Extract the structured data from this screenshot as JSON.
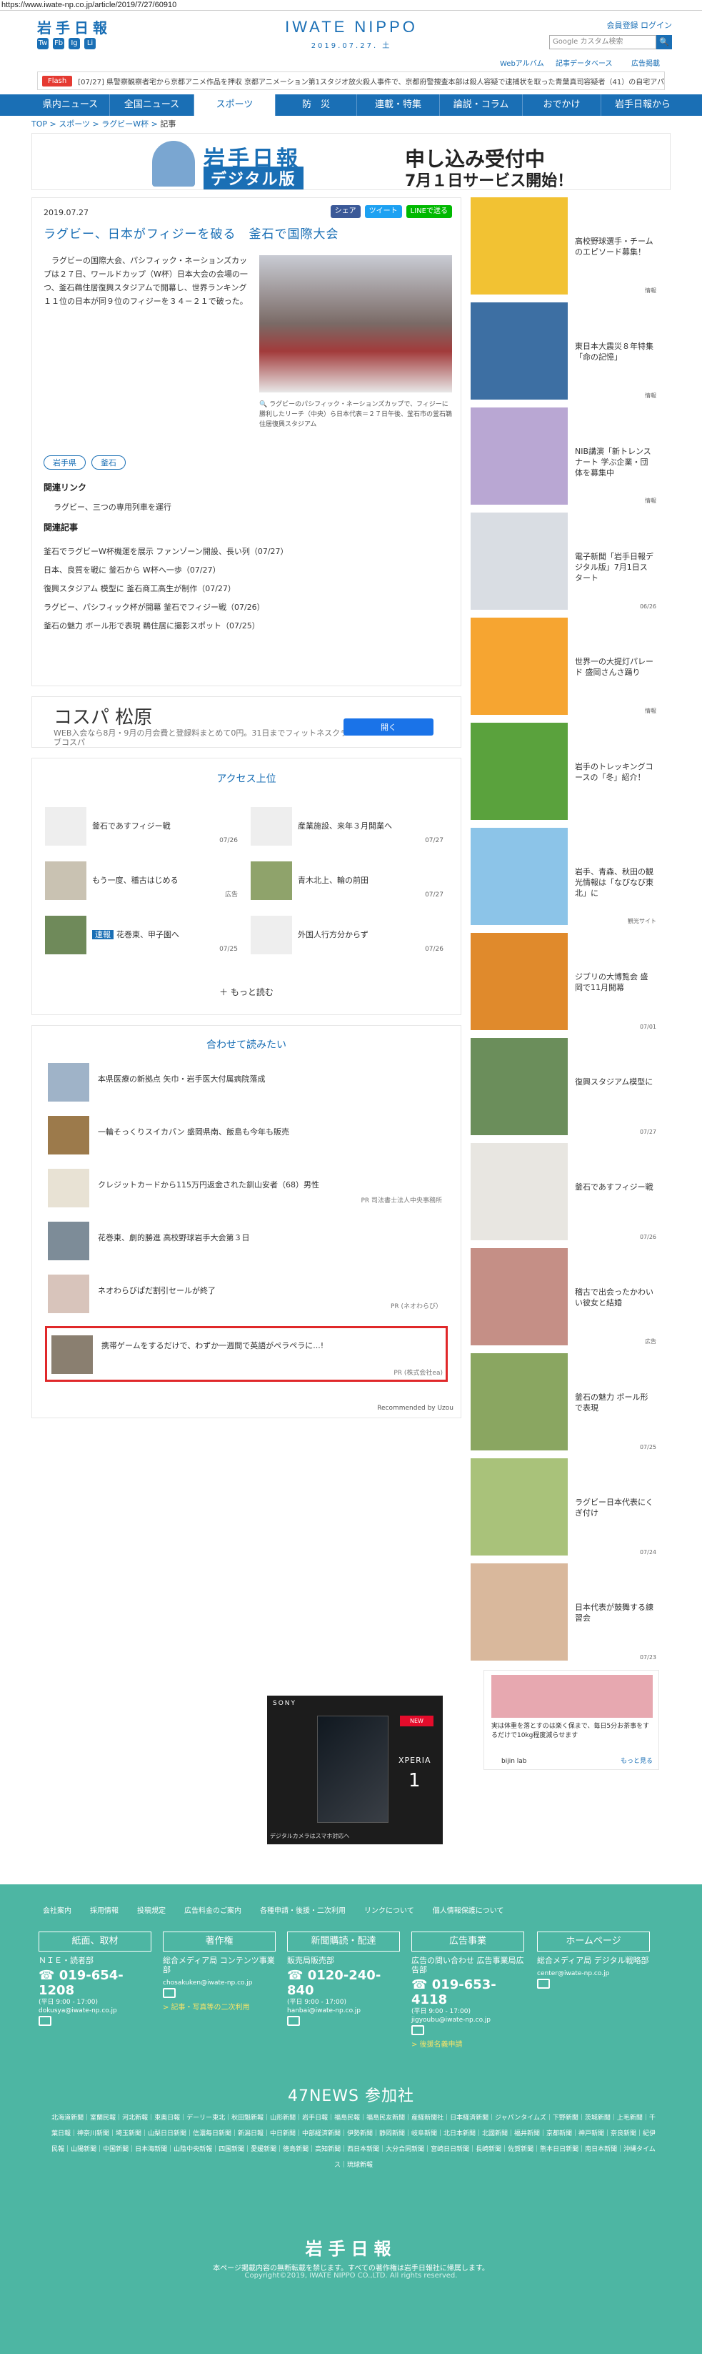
{
  "browser": {
    "url": "https://www.iwate-np.co.jp/article/2019/7/27/60910"
  },
  "header": {
    "logo": "岩手日報",
    "brand": "IWATE NIPPO",
    "date": "2019.07.27. 土",
    "register": "会員登録  ログイン",
    "search_placeholder": "Google カスタム検索",
    "search_btn": "🔍",
    "links": [
      "Webアルバム",
      "記事データベース",
      "広告掲載"
    ],
    "social": [
      "Tw",
      "Fb",
      "Ig",
      "Li"
    ]
  },
  "flash": {
    "tag": "Flash",
    "text": "[07/27] 県警察観察者宅から京都アニメ作品を押収   京都アニメーション第1スタジオ放火殺人事件で、京都府警捜査本部は殺人容疑で逮捕状を取った青葉真司容疑者（41）の自宅アパートから、京アニ..."
  },
  "nav": [
    "県内ニュース",
    "全国ニュース",
    "スポーツ",
    "防　災",
    "連載・特集",
    "論説・コラム",
    "おでかけ",
    "岩手日報から"
  ],
  "breadcrumb": [
    "TOP",
    "スポーツ",
    "ラグビーW杯",
    "記事"
  ],
  "banner": {
    "l1": "岩手日報",
    "l2": "デジタル版",
    "r1": "申し込み受付中",
    "r2": "7月１日サービス開始！"
  },
  "article": {
    "date": "2019.07.27",
    "share": [
      "シェア",
      "ツイート",
      "LINEで送る"
    ],
    "title": "ラグビー、日本がフィジーを破る　釜石で国際大会",
    "body": "　ラグビーの国際大会、パシフィック・ネーションズカップは２７日、ワールドカップ（W杯）日本大会の会場の一つ、釜石鵜住居復興スタジアムで開幕し、世界ランキング１１位の日本が同９位のフィジーを３４－２１で破った。",
    "caption": "🔍 ラグビーのパシフィック・ネーションズカップで、フィジーに勝利したリーチ（中央）ら日本代表＝２７日午後、釜石市の釜石鵜住居復興スタジアム",
    "tags": [
      "岩手県",
      "釜石"
    ],
    "rel_link_h": "関連リンク",
    "rel_link": "ラグビー、三つの専用列車を運行",
    "rel_art_h": "関連記事",
    "rel_articles": [
      "釜石でラグビーW杯機運を展示  ファンゾーン開設、長い列（07/27）",
      "日本、良質を戦に  釜石から W杯へ一歩（07/27）",
      "復興スタジアム  模型に  釜石商工高生が制作（07/27）",
      "ラグビー、パシフィック杯が開幕  釜石でフィジー戦（07/26）",
      "釜石の魅力  ボール形で表現  鵜住居に撮影スポット（07/25）"
    ]
  },
  "ad": {
    "title": "コスパ 松原",
    "sub": "WEB入会なら8月・9月の月会費と登録料まとめて0円。31日までフィットネスクラブコスパ",
    "btn": "開く"
  },
  "ranking": {
    "title": "アクセス上位",
    "items": [
      {
        "t": "釜石であすフィジー戦",
        "d": "07/26"
      },
      {
        "t": "産業施設、来年３月開業へ",
        "d": "07/27"
      },
      {
        "t": "もう一度、稽古はじめる",
        "d": "広告"
      },
      {
        "t": "青木北上、輪の前田",
        "d": "07/27"
      },
      {
        "t": "花巻東、甲子園へ",
        "d": "07/25"
      },
      {
        "t": "外国人行方分からず",
        "d": "07/26"
      }
    ],
    "badge": "速報",
    "more": "もっと読む"
  },
  "recommend": {
    "title": "合わせて読みたい",
    "items": [
      {
        "t": "本県医療の新拠点  矢巾・岩手医大付属病院落成",
        "pr": ""
      },
      {
        "t": "一輪そっくりスイカパン  盛岡県南、飯島も今年も販売",
        "pr": ""
      },
      {
        "t": "クレジットカードから115万円返金された釧山安者（68）男性",
        "pr": "PR 司法書士法人中央事務所"
      },
      {
        "t": "花巻東、劇的勝進  高校野球岩手大会第３日",
        "pr": ""
      },
      {
        "t": "ネオわらびぱだ割引セールが終了",
        "pr": "PR (ネオわらび）"
      },
      {
        "t": "携帯ゲームをするだけで、わずか一週間で英語がペラペラに...!",
        "pr": "PR (株式会社ea)"
      }
    ],
    "powered": "Recommended by Uzou"
  },
  "sony": {
    "brand": "SONY",
    "model": "XPERIA",
    "num": "1",
    "new": "NEW",
    "foot": "デジタルカメラはスマホ対応へ"
  },
  "sidebar": {
    "cards": [
      {
        "t": "高校野球選手・チームのエピソード募集！",
        "d": "情報"
      },
      {
        "t": "東日本大震災８年特集「命の記憶」",
        "d": "情報"
      },
      {
        "t": "NIB講演「新トレンスナート  学ぶ企業・団体を募集中",
        "d": "情報"
      },
      {
        "t": "電子新聞「岩手日報デジタル版」7月1日スタート",
        "d": "06/26"
      },
      {
        "t": "世界一の大提灯パレード  盛岡さんさ踊り",
        "d": "情報"
      },
      {
        "t": "岩手のトレッキングコースの「冬」紹介！",
        "d": ""
      },
      {
        "t": "岩手、青森、秋田の観光情報は「なびなび東北」に",
        "d": "観光サイト"
      },
      {
        "t": "ジブリの大博覧会  盛岡で11月開幕",
        "d": "07/01"
      },
      {
        "t": "復興スタジアム模型に",
        "d": "07/27"
      },
      {
        "t": "釜石であすフィジー戦",
        "d": "07/26"
      },
      {
        "t": "稽古で出会ったかわいい彼女と結婚",
        "d": "広告"
      },
      {
        "t": "釜石の魅力  ボール形で表現",
        "d": "07/25"
      },
      {
        "t": "ラグビー日本代表にくぎ付け",
        "d": "07/24"
      },
      {
        "t": "日本代表が鼓舞する練習会",
        "d": "07/23"
      }
    ],
    "ad_text": "実は体重を落とすのは楽く保まで、毎日5分お茶事をするだけで10kg程度減らせます",
    "ad_brand": "bijin lab",
    "ad_more": "もっと見る"
  },
  "footer": {
    "links": [
      "会社案内",
      "採用情報",
      "投稿規定",
      "広告料金のご案内",
      "各種申請・後援・二次利用",
      "リンクについて",
      "個人情報保護について"
    ],
    "cols": [
      {
        "h": "紙面、取材",
        "l": "ＮＩＥ・読者部",
        "tel": "019-654-1208",
        "sm": "(平日 9:00 - 17:00)",
        "mail": "dokusya@iwate-np.co.jp",
        "y": ""
      },
      {
        "h": "著作権",
        "l": "総合メディア局 コンテンツ事業部",
        "tel": "",
        "sm": "chosakuken@iwate-np.co.jp",
        "mail": "",
        "y": "> 記事・写真等の二次利用"
      },
      {
        "h": "新聞購読・配達",
        "l": "販売局販売部",
        "tel": "0120-240-840",
        "sm": "(平日 9:00 - 17:00)",
        "mail": "hanbai@iwate-np.co.jp",
        "y": ""
      },
      {
        "h": "広告事業",
        "l": "広告の問い合わせ 広告事業局広告部",
        "tel": "019-653-4118",
        "sm": "(平日 9:00 - 17:00)",
        "mail": "jigyoubu@iwate-np.co.jp",
        "y": "> 後援名義申請"
      },
      {
        "h": "ホームページ",
        "l": "総合メディア局 デジタル戦略部",
        "tel": "",
        "sm": "center@iwate-np.co.jp",
        "mail": "",
        "y": ""
      }
    ],
    "n47": "47NEWS 参加社",
    "papers": "北海道新聞｜室蘭民報｜河北新報｜東奥日報｜デーリー東北｜秋田魁新報｜山形新聞｜岩手日報｜福島民報｜福島民友新聞｜産経新聞社｜日本経済新聞｜ジャパンタイムズ｜下野新聞｜茨城新聞｜上毛新聞｜千葉日報｜神奈川新聞｜埼玉新聞｜山梨日日新聞｜信濃毎日新聞｜新潟日報｜中日新聞｜中部経済新聞｜伊勢新聞｜静岡新聞｜岐阜新聞｜北日本新聞｜北國新聞｜福井新聞｜京都新聞｜神戸新聞｜奈良新聞｜紀伊民報｜山陽新聞｜中国新聞｜日本海新聞｜山陰中央新報｜四国新聞｜愛媛新聞｜徳島新聞｜高知新聞｜西日本新聞｜大分合同新聞｜宮崎日日新聞｜長崎新聞｜佐賀新聞｜熊本日日新聞｜南日本新聞｜沖縄タイムス｜琉球新報",
    "bl": "岩手日報",
    "cp1": "本ページ掲載内容の無断転載を禁じます。すべての著作権は岩手日報社に帰属します。",
    "cp2": "Copyright©2019, IWATE NIPPO CO.,LTD. All rights reserved."
  }
}
